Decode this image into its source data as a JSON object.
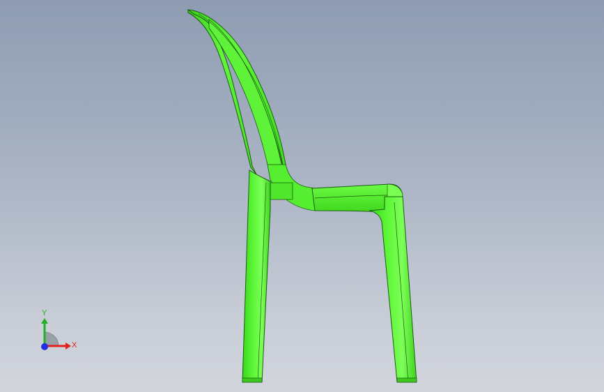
{
  "viewport": {
    "background_top": "#8e9cb2",
    "background_bottom": "#d2d5dc"
  },
  "model": {
    "part_color": "#4df02a",
    "edge_color": "#1a5c10"
  },
  "triad": {
    "x_label": "X",
    "y_label": "Y",
    "x_color": "#e02020",
    "y_color": "#20b020",
    "z_color": "#2030e0"
  }
}
